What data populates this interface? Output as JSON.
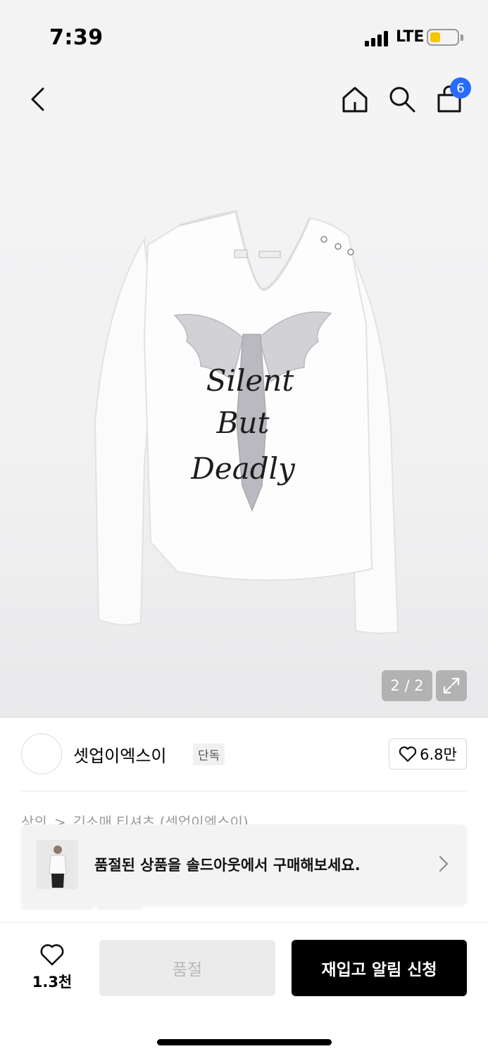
{
  "status_bar": {
    "time": "7:39",
    "network": "LTE",
    "battery_color": "#f7c600"
  },
  "nav": {
    "back_icon": "chevron-left-icon",
    "home_icon": "home-icon",
    "search_icon": "search-icon",
    "bag_icon": "shopping-bag-icon",
    "bag_count": "6"
  },
  "product_image": {
    "print_lines": [
      "Silent",
      "But",
      "Deadly"
    ],
    "counter": "2 / 2",
    "expand_icon": "expand-icon"
  },
  "brand": {
    "name": "셋업이엑스이",
    "badge": "단독",
    "like_count": "6.8만"
  },
  "breadcrumb": {
    "category": "상의",
    "separator": ">",
    "sub": "긴소매 티셔츠 (셋업이엑스이)"
  },
  "banner": {
    "text": "품절된 상품을 솔드아웃에서 구매해보세요."
  },
  "bottom_bar": {
    "wish_count": "1.3천",
    "soldout_label": "품절",
    "restock_label": "재입고 알림 신청"
  },
  "colors": {
    "accent_blue": "#2a6bff",
    "primary_button": "#000000",
    "disabled_button": "#ebebeb"
  }
}
